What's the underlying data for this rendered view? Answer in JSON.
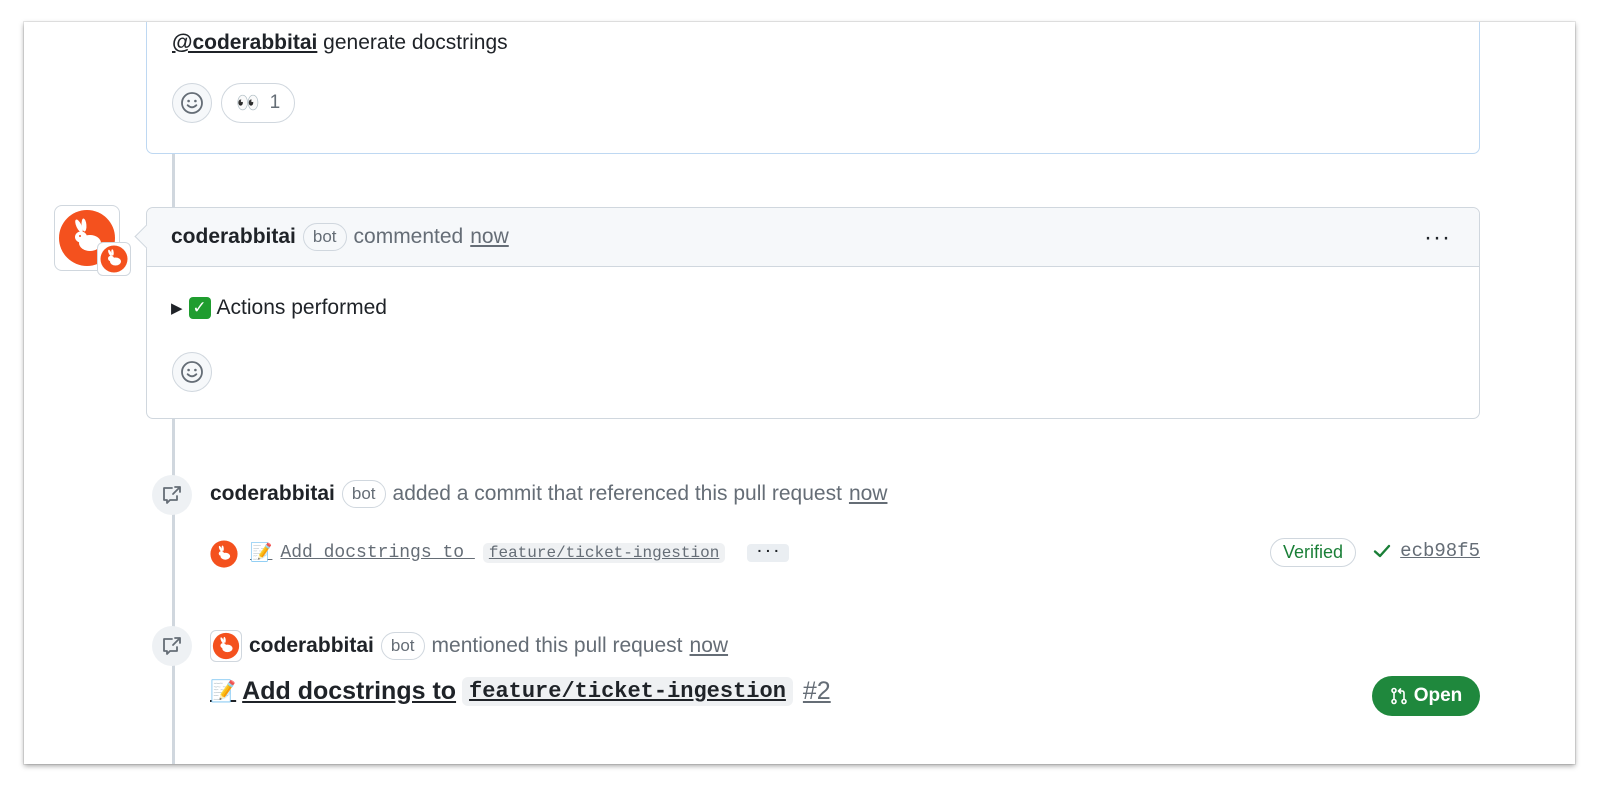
{
  "top_comment": {
    "mention": "@coderabbitai",
    "text": " generate docstrings",
    "reaction": {
      "emoji": "👀",
      "count": "1"
    }
  },
  "comment": {
    "author": "coderabbitai",
    "badge": "bot",
    "action": "commented",
    "time": "now",
    "menu": "···",
    "details_marker": "▶",
    "details_emoji": "✓",
    "details_summary": "Actions performed"
  },
  "commit_event": {
    "author": "coderabbitai",
    "badge": "bot",
    "action": "added a commit that referenced this pull request",
    "time": "now",
    "commit": {
      "emoji": "📝",
      "message": "Add docstrings to ",
      "branch": "feature/ticket-ingestion",
      "more": "···",
      "verified": "Verified",
      "sha": "ecb98f5"
    }
  },
  "mention_event": {
    "author": "coderabbitai",
    "badge": "bot",
    "action": "mentioned this pull request",
    "time": "now",
    "pr": {
      "emoji": "📝",
      "title": "Add docstrings to",
      "branch": "feature/ticket-ingestion",
      "number": "#2",
      "state": "Open"
    }
  },
  "colors": {
    "brand_orange": "#f4511e",
    "open_green": "#1f883d",
    "verified_green": "#1a7f37",
    "border": "#d0d7de",
    "focus_border": "#bed8f2"
  }
}
